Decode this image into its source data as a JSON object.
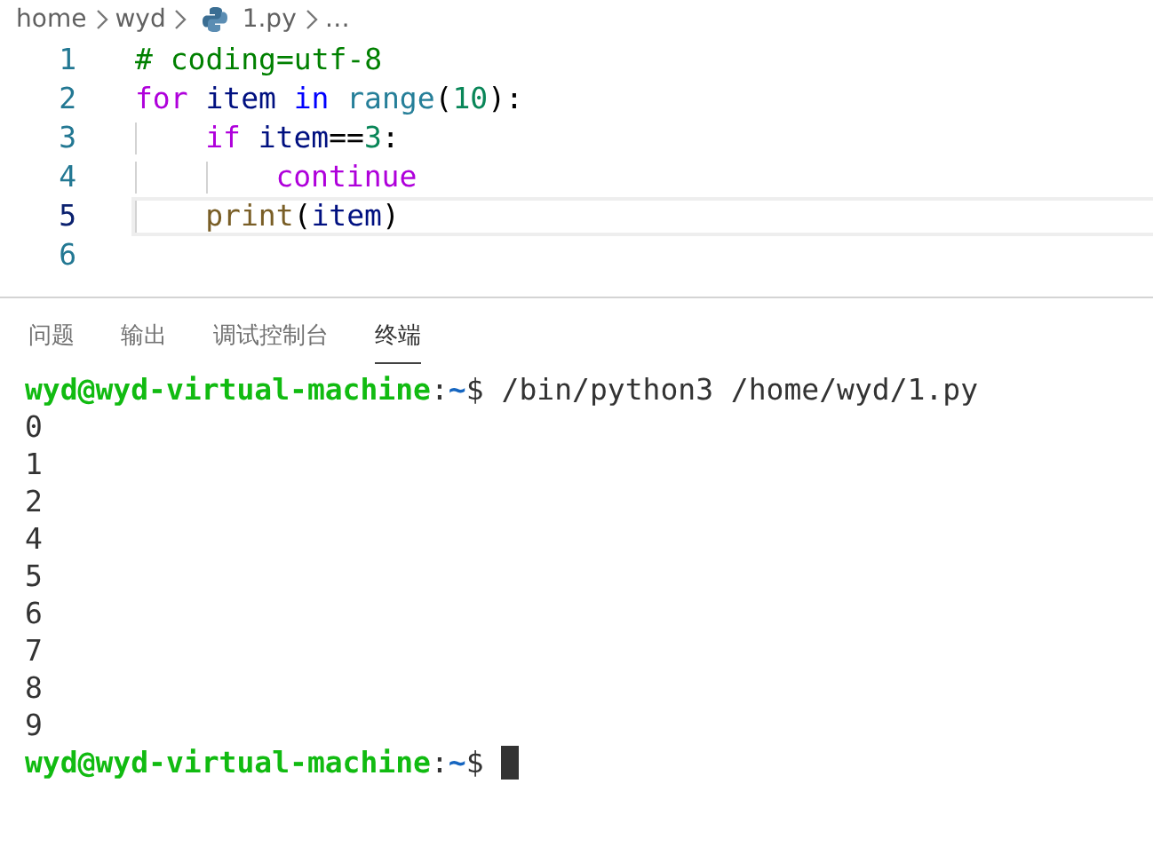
{
  "breadcrumb": [
    {
      "text": "home",
      "kind": "folder"
    },
    {
      "text": "wyd",
      "kind": "folder"
    },
    {
      "text": "1.py",
      "kind": "python"
    },
    {
      "text": "…",
      "kind": "more"
    }
  ],
  "editor": {
    "lines": [
      {
        "number": "1",
        "current": false,
        "tokens": [
          {
            "text": "# coding=utf-8",
            "kind": "comment"
          }
        ]
      },
      {
        "number": "2",
        "current": false,
        "tokens": [
          {
            "text": "for",
            "kind": "keyword"
          },
          {
            "text": "item",
            "kind": "variable",
            "space": true
          },
          {
            "text": "in",
            "kind": "operator",
            "space": true
          },
          {
            "text": "range",
            "kind": "builtin",
            "space": true
          },
          {
            "text": "(",
            "kind": "plain"
          },
          {
            "text": "10",
            "kind": "number"
          },
          {
            "text": "):",
            "kind": "plain"
          }
        ],
        "children": [
          {
            "number": "3",
            "current": false,
            "tokens": [
              {
                "text": "if",
                "kind": "keyword"
              },
              {
                "text": "item",
                "kind": "variable",
                "space": true
              },
              {
                "text": "==",
                "kind": "plain"
              },
              {
                "text": "3",
                "kind": "number"
              },
              {
                "text": ":",
                "kind": "plain"
              }
            ],
            "children": [
              {
                "number": "4",
                "current": false,
                "tokens": [
                  {
                    "text": "continue",
                    "kind": "keyword"
                  }
                ]
              }
            ]
          },
          {
            "number": "5",
            "current": true,
            "tokens": [
              {
                "text": "print",
                "kind": "function"
              },
              {
                "text": "(",
                "kind": "plain"
              },
              {
                "text": "item",
                "kind": "variable"
              },
              {
                "text": ")",
                "kind": "plain"
              }
            ]
          }
        ]
      },
      {
        "number": "6",
        "current": false
      }
    ]
  },
  "panel": {
    "tabs": [
      {
        "label": "问题",
        "selected": false
      },
      {
        "label": "输出",
        "selected": false
      },
      {
        "label": "调试控制台",
        "selected": false
      },
      {
        "label": "终端",
        "selected": true
      }
    ]
  },
  "terminal": {
    "lines": [
      {
        "kind": "prompt",
        "user": "wyd@wyd-virtual-machine",
        "sep": ":",
        "path": "~",
        "symbol": "$",
        "command": "/bin/python3 /home/wyd/1.py"
      },
      {
        "kind": "output",
        "text": "0"
      },
      {
        "kind": "output",
        "text": "1"
      },
      {
        "kind": "output",
        "text": "2"
      },
      {
        "kind": "output",
        "text": "4"
      },
      {
        "kind": "output",
        "text": "5"
      },
      {
        "kind": "output",
        "text": "6"
      },
      {
        "kind": "output",
        "text": "7"
      },
      {
        "kind": "output",
        "text": "8"
      },
      {
        "kind": "output",
        "text": "9"
      },
      {
        "kind": "prompt",
        "user": "wyd@wyd-virtual-machine",
        "sep": ":",
        "path": "~",
        "symbol": "$",
        "cursor": true
      }
    ]
  }
}
